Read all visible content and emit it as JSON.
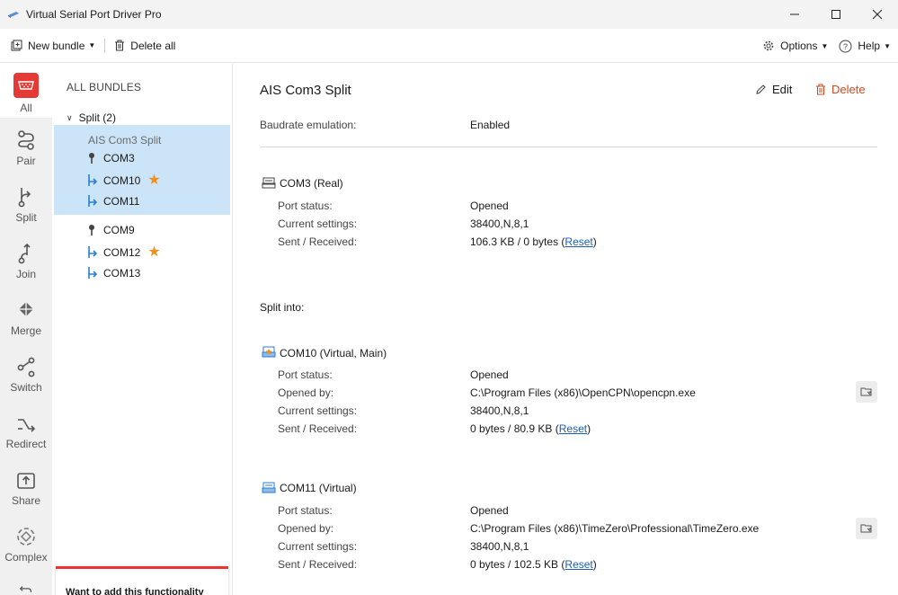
{
  "window": {
    "title": "Virtual Serial Port Driver Pro"
  },
  "toolbar": {
    "new_bundle": "New bundle",
    "delete_all": "Delete all",
    "options": "Options",
    "help": "Help"
  },
  "rail": {
    "items": [
      {
        "label": "All",
        "icon": "serial-port-icon"
      },
      {
        "label": "Pair",
        "icon": "pair-icon"
      },
      {
        "label": "Split",
        "icon": "split-icon"
      },
      {
        "label": "Join",
        "icon": "join-icon"
      },
      {
        "label": "Merge",
        "icon": "merge-icon"
      },
      {
        "label": "Switch",
        "icon": "switch-icon"
      },
      {
        "label": "Redirect",
        "icon": "redirect-icon"
      },
      {
        "label": "Share",
        "icon": "share-icon"
      },
      {
        "label": "Complex",
        "icon": "complex-icon"
      }
    ]
  },
  "tree": {
    "header": "ALL BUNDLES",
    "group": "Split (2)",
    "bundles": [
      {
        "name": "AIS Com3 Split",
        "ports": [
          "COM3",
          "COM10",
          "COM11"
        ],
        "starred": "COM10"
      },
      {
        "name": "",
        "ports": [
          "COM9",
          "COM12",
          "COM13"
        ],
        "starred": "COM12"
      }
    ],
    "promo": "Want to add this functionality"
  },
  "main": {
    "title": "AIS Com3 Split",
    "edit": "Edit",
    "delete": "Delete",
    "baudrate_label": "Baudrate emulation:",
    "baudrate_value": "Enabled",
    "split_into": "Split into:",
    "ports": [
      {
        "title": "COM3 (Real)",
        "port_status_label": "Port status:",
        "port_status": "Opened",
        "settings_label": "Current settings:",
        "settings": "38400,N,8,1",
        "sent_label": "Sent / Received:",
        "sent": "106.3 KB / 0 bytes",
        "reset": "Reset"
      },
      {
        "title": "COM10 (Virtual, Main)",
        "port_status_label": "Port status:",
        "port_status": "Opened",
        "opened_by_label": "Opened by:",
        "opened_by": "C:\\Program Files (x86)\\OpenCPN\\opencpn.exe",
        "settings_label": "Current settings:",
        "settings": "38400,N,8,1",
        "sent_label": "Sent / Received:",
        "sent": "0 bytes / 80.9 KB",
        "reset": "Reset"
      },
      {
        "title": "COM11 (Virtual)",
        "port_status_label": "Port status:",
        "port_status": "Opened",
        "opened_by_label": "Opened by:",
        "opened_by": "C:\\Program Files (x86)\\TimeZero\\Professional\\TimeZero.exe",
        "settings_label": "Current settings:",
        "settings": "38400,N,8,1",
        "sent_label": "Sent / Received:",
        "sent": "0 bytes / 102.5 KB",
        "reset": "Reset"
      }
    ]
  },
  "colors": {
    "accent": "#2b7fd4",
    "delete": "#d04a1e",
    "selection": "#cce4f7",
    "star": "#f0901a",
    "rail_active": "#e53935"
  }
}
